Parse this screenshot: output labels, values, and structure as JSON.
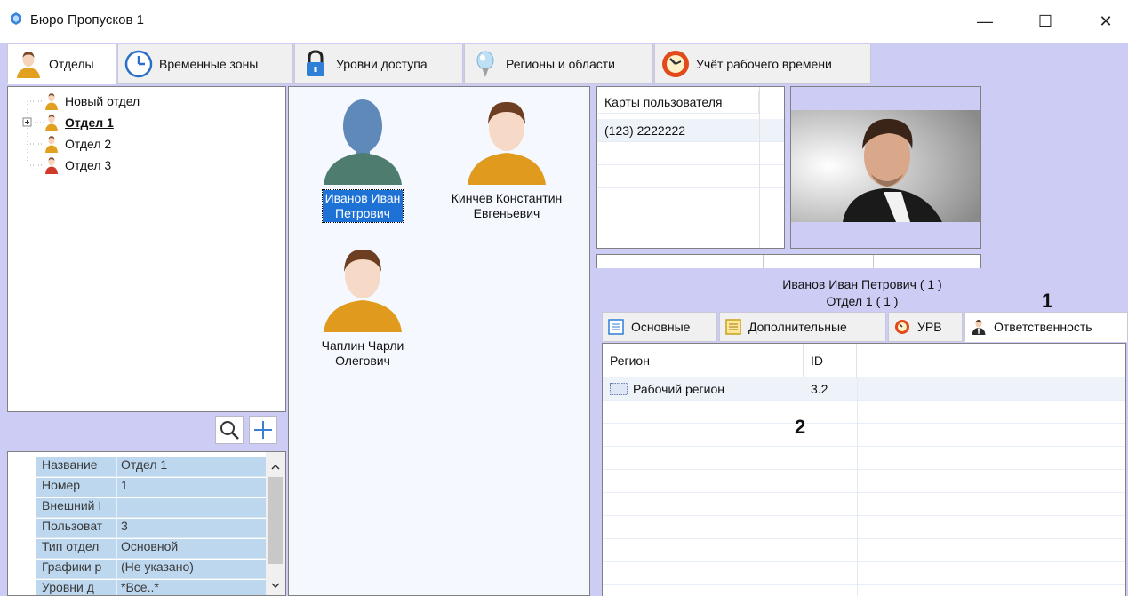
{
  "window": {
    "title": "Бюро Пропусков 1",
    "minimize_glyph": "—",
    "maximize_glyph": "☐",
    "close_glyph": "✕"
  },
  "main_tabs": [
    {
      "label": "Отделы",
      "icon": "person-icon",
      "active": true
    },
    {
      "label": "Временные зоны",
      "icon": "clock-icon",
      "active": false
    },
    {
      "label": "Уровни доступа",
      "icon": "lock-icon",
      "active": false
    },
    {
      "label": "Регионы и области",
      "icon": "pin-icon",
      "active": false
    },
    {
      "label": "Учёт рабочего времени",
      "icon": "stopwatch-icon",
      "active": false
    }
  ],
  "tree": {
    "items": [
      {
        "label": "Новый отдел",
        "bold": false
      },
      {
        "label": "Отдел 1",
        "bold": true,
        "expandable": true
      },
      {
        "label": "Отдел 2",
        "bold": false
      },
      {
        "label": "Отдел 3",
        "bold": false
      }
    ]
  },
  "tree_toolbar": {
    "search": "search-icon",
    "add": "plus-icon"
  },
  "properties": {
    "rows": [
      {
        "key": "Название",
        "value": "Отдел 1"
      },
      {
        "key": "Номер",
        "value": "1"
      },
      {
        "key": "Внешний I",
        "value": ""
      },
      {
        "key": "Пользоват",
        "value": "3"
      },
      {
        "key": "Тип отдел",
        "value": "Основной"
      },
      {
        "key": "Графики р",
        "value": "(Не указано)"
      },
      {
        "key": "Уровни д",
        "value": "*Все..*"
      }
    ]
  },
  "people": [
    {
      "name_line1": "Иванов Иван",
      "name_line2": "Петрович",
      "selected": true
    },
    {
      "name_line1": "Кинчев Константин",
      "name_line2": "Евгеньевич",
      "selected": false
    },
    {
      "name_line1": "Чаплин Чарли",
      "name_line2": "Олегович",
      "selected": false
    }
  ],
  "user_cards": {
    "header": "Карты пользователя",
    "rows": [
      "(123) 2222222"
    ]
  },
  "selection": {
    "name": "Иванов Иван Петрович ( 1 )",
    "dept": "Отдел 1 ( 1 )"
  },
  "annotations": {
    "one": "1",
    "two": "2"
  },
  "sub_tabs": [
    {
      "label": "Основные",
      "icon": "list-icon",
      "active": false
    },
    {
      "label": "Дополнительные",
      "icon": "list-icon",
      "active": false
    },
    {
      "label": "УРВ",
      "icon": "stopwatch-icon",
      "active": false
    },
    {
      "label": "Ответственность",
      "icon": "manager-icon",
      "active": true
    }
  ],
  "responsibility": {
    "columns": [
      "Регион",
      "ID"
    ],
    "rows": [
      {
        "region": "Рабочий регион",
        "id": "3.2"
      }
    ]
  },
  "colors": {
    "workspace": "#ccccf4",
    "selection": "#1e72d6",
    "property_cell": "#bcd7ee"
  }
}
